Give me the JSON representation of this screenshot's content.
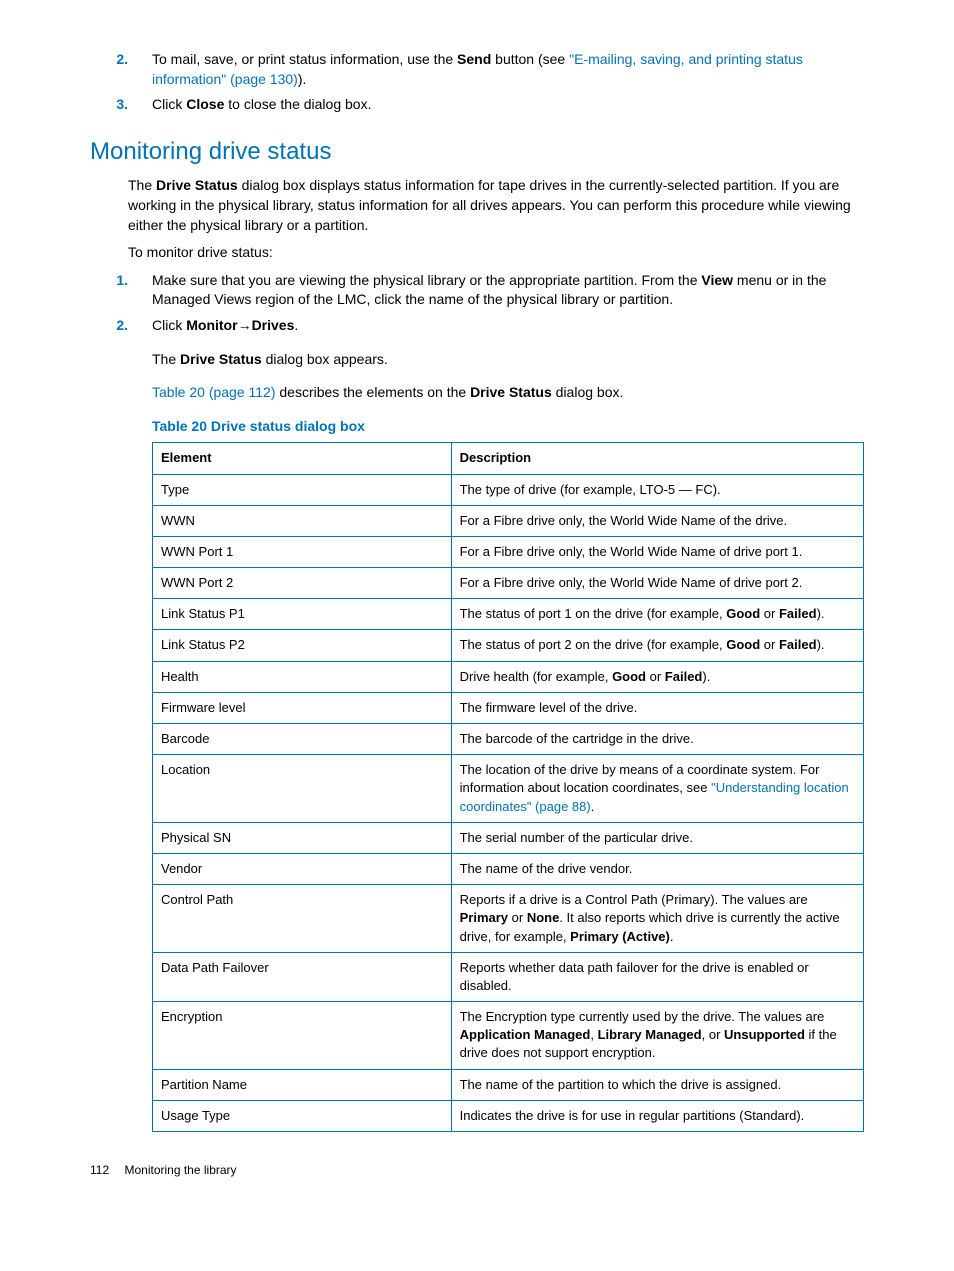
{
  "intro_list": {
    "item2": {
      "num": "2.",
      "pre": "To mail, save, or print status information, use the ",
      "bold1": "Send",
      "mid": " button (see ",
      "link": "\"E-mailing, saving, and printing status information\" (page 130)",
      "post": ")."
    },
    "item3": {
      "num": "3.",
      "pre": "Click ",
      "bold1": "Close",
      "post": " to close the dialog box."
    }
  },
  "heading": "Monitoring drive status",
  "para1": {
    "pre": "The ",
    "bold": "Drive Status",
    "post": " dialog box displays status information for tape drives in the currently-selected partition. If you are working in the physical library, status information for all drives appears. You can perform this procedure while viewing either the physical library or a partition."
  },
  "para2": "To monitor drive status:",
  "steps": {
    "s1": {
      "num": "1.",
      "pre": "Make sure that you are viewing the physical library or the appropriate partition. From the ",
      "bold": "View",
      "post": " menu or in the Managed Views region of the LMC, click the name of the physical library or partition."
    },
    "s2": {
      "num": "2.",
      "pre": "Click ",
      "bold1": "Monitor",
      "arrow": "→",
      "bold2": "Drives",
      "post": "."
    }
  },
  "nested1": {
    "pre": "The ",
    "bold": "Drive Status",
    "post": " dialog box appears."
  },
  "nested2": {
    "link": "Table 20 (page 112)",
    "mid": " describes the elements on the ",
    "bold": "Drive Status",
    "post": " dialog box."
  },
  "table_caption": "Table 20 Drive status dialog box",
  "th1": "Element",
  "th2": "Description",
  "rows": {
    "r0": {
      "e": "Type",
      "d_pre": "The type of drive (for example, LTO-5 — FC)."
    },
    "r1": {
      "e": "WWN",
      "d_pre": "For a Fibre drive only, the World Wide Name of the drive."
    },
    "r2": {
      "e": "WWN Port 1",
      "d_pre": "For a Fibre drive only, the World Wide Name of drive port 1."
    },
    "r3": {
      "e": "WWN Port 2",
      "d_pre": "For a Fibre drive only, the World Wide Name of drive port 2."
    },
    "r4": {
      "e": "Link Status P1",
      "d_pre": "The status of port 1 on the drive (for example, ",
      "b1": "Good",
      "d_mid": " or ",
      "b2": "Failed",
      "d_post": ")."
    },
    "r5": {
      "e": "Link Status P2",
      "d_pre": "The status of port 2 on the drive (for example, ",
      "b1": "Good",
      "d_mid": " or ",
      "b2": "Failed",
      "d_post": ")."
    },
    "r6": {
      "e": "Health",
      "d_pre": "Drive health (for example, ",
      "b1": "Good",
      "d_mid": " or ",
      "b2": "Failed",
      "d_post": ")."
    },
    "r7": {
      "e": "Firmware level",
      "d_pre": "The firmware level of the drive."
    },
    "r8": {
      "e": "Barcode",
      "d_pre": "The barcode of the cartridge in the drive."
    },
    "r9": {
      "e": "Location",
      "d_pre": "The location of the drive by means of a coordinate system. For information about location coordinates, see ",
      "link": "\"Understanding location coordinates\" (page 88)",
      "d_post": "."
    },
    "r10": {
      "e": "Physical SN",
      "d_pre": "The serial number of the particular drive."
    },
    "r11": {
      "e": "Vendor",
      "d_pre": "The name of the drive vendor."
    },
    "r12": {
      "e": "Control Path",
      "d_pre": "Reports if a drive is a Control Path (Primary). The values are ",
      "b1": "Primary",
      "d_mid": " or ",
      "b2": "None",
      "d_mid2": ". It also reports which drive is currently the active drive, for example, ",
      "b3": "Primary (Active)",
      "d_post": "."
    },
    "r13": {
      "e": "Data Path Failover",
      "d_pre": "Reports whether data path failover for the drive is enabled or disabled."
    },
    "r14": {
      "e": "Encryption",
      "d_pre": "The Encryption type currently used by the drive. The values are ",
      "b1": "Application Managed",
      "d_mid": ", ",
      "b2": "Library Managed",
      "d_mid2": ", or ",
      "b3": "Unsupported",
      "d_post": " if the drive does not support encryption."
    },
    "r15": {
      "e": "Partition Name",
      "d_pre": "The name of the partition to which the drive is assigned."
    },
    "r16": {
      "e": "Usage Type",
      "d_pre": "Indicates the drive is for use in regular partitions (Standard)."
    }
  },
  "footer": {
    "page": "112",
    "text": "Monitoring the library"
  }
}
